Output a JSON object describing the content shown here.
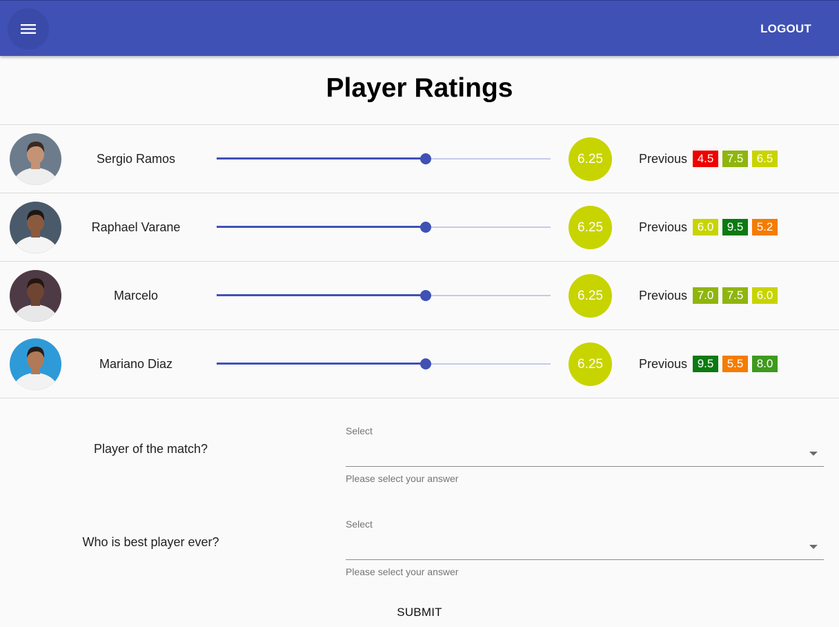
{
  "header": {
    "menu_icon": "hamburger-menu-icon",
    "logout_label": "LOGOUT",
    "color": "#3f51b5"
  },
  "page_title": "Player Ratings",
  "players": [
    {
      "name": "Sergio Ramos",
      "rating": "6.25",
      "slider_fraction": 0.625,
      "previous_label": "Previous",
      "previous": [
        {
          "value": "4.5",
          "color": "#f00000"
        },
        {
          "value": "7.5",
          "color": "#8fb50e"
        },
        {
          "value": "6.5",
          "color": "#c8d400"
        }
      ],
      "avatar_colors": {
        "bg": "#6d7c8c",
        "skin": "#c49375",
        "hair": "#3a2a22",
        "shirt": "#eeeeee"
      }
    },
    {
      "name": "Raphael Varane",
      "rating": "6.25",
      "slider_fraction": 0.625,
      "previous_label": "Previous",
      "previous": [
        {
          "value": "6.0",
          "color": "#c8d400"
        },
        {
          "value": "9.5",
          "color": "#0b7a12"
        },
        {
          "value": "5.2",
          "color": "#f57c00"
        }
      ],
      "avatar_colors": {
        "bg": "#4a5a6a",
        "skin": "#8a5a3f",
        "hair": "#1d1612",
        "shirt": "#f4f4f4"
      }
    },
    {
      "name": "Marcelo",
      "rating": "6.25",
      "slider_fraction": 0.625,
      "previous_label": "Previous",
      "previous": [
        {
          "value": "7.0",
          "color": "#8fb50e"
        },
        {
          "value": "7.5",
          "color": "#8fb50e"
        },
        {
          "value": "6.0",
          "color": "#c8d400"
        }
      ],
      "avatar_colors": {
        "bg": "#4e3a45",
        "skin": "#6e4532",
        "hair": "#24160f",
        "shirt": "#e8e8e8"
      }
    },
    {
      "name": "Mariano Diaz",
      "rating": "6.25",
      "slider_fraction": 0.625,
      "previous_label": "Previous",
      "previous": [
        {
          "value": "9.5",
          "color": "#0b7a12"
        },
        {
          "value": "5.5",
          "color": "#f57c00"
        },
        {
          "value": "8.0",
          "color": "#3e9a1e"
        }
      ],
      "avatar_colors": {
        "bg": "#2f9ad8",
        "skin": "#b07a58",
        "hair": "#2a1c14",
        "shirt": "#f2f2f2"
      }
    }
  ],
  "rating_badge_color": "#c8d400",
  "questions": [
    {
      "label": "Player of the match?",
      "select_label": "Select",
      "value": "",
      "helper": "Please select your answer"
    },
    {
      "label": "Who is best player ever?",
      "select_label": "Select",
      "value": "",
      "helper": "Please select your answer"
    }
  ],
  "submit_label": "SUBMIT"
}
